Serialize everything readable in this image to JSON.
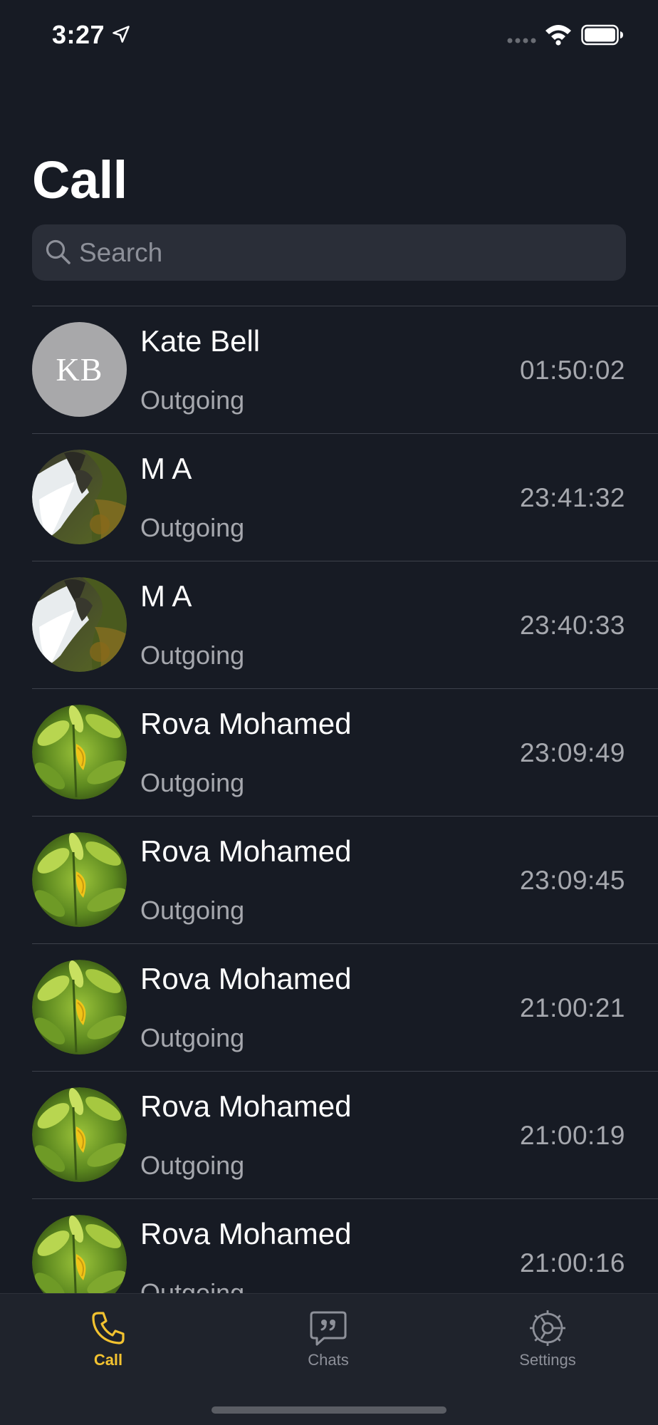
{
  "status_bar": {
    "time": "3:27"
  },
  "title": "Call",
  "search": {
    "placeholder": "Search",
    "value": ""
  },
  "calls": [
    {
      "name": "Kate Bell",
      "type": "Outgoing",
      "time": "01:50:02",
      "avatar": "initials",
      "initials": "KB"
    },
    {
      "name": "M A",
      "type": "Outgoing",
      "time": "23:41:32",
      "avatar": "waterfall-photo"
    },
    {
      "name": "M A",
      "type": "Outgoing",
      "time": "23:40:33",
      "avatar": "waterfall-photo"
    },
    {
      "name": "Rova Mohamed",
      "type": "Outgoing",
      "time": "23:09:49",
      "avatar": "leaf-photo"
    },
    {
      "name": "Rova Mohamed",
      "type": "Outgoing",
      "time": "23:09:45",
      "avatar": "leaf-photo"
    },
    {
      "name": "Rova Mohamed",
      "type": "Outgoing",
      "time": "21:00:21",
      "avatar": "leaf-photo"
    },
    {
      "name": "Rova Mohamed",
      "type": "Outgoing",
      "time": "21:00:19",
      "avatar": "leaf-photo"
    },
    {
      "name": "Rova Mohamed",
      "type": "Outgoing",
      "time": "21:00:16",
      "avatar": "leaf-photo"
    }
  ],
  "tabs": [
    {
      "label": "Call",
      "icon": "phone-icon",
      "active": true
    },
    {
      "label": "Chats",
      "icon": "chat-bubble-icon",
      "active": false
    },
    {
      "label": "Settings",
      "icon": "gear-icon",
      "active": false
    }
  ],
  "colors": {
    "background": "#171b24",
    "accent": "#f2c230",
    "secondary_text": "#a6a8ae",
    "search_bg": "#2a2e38"
  }
}
